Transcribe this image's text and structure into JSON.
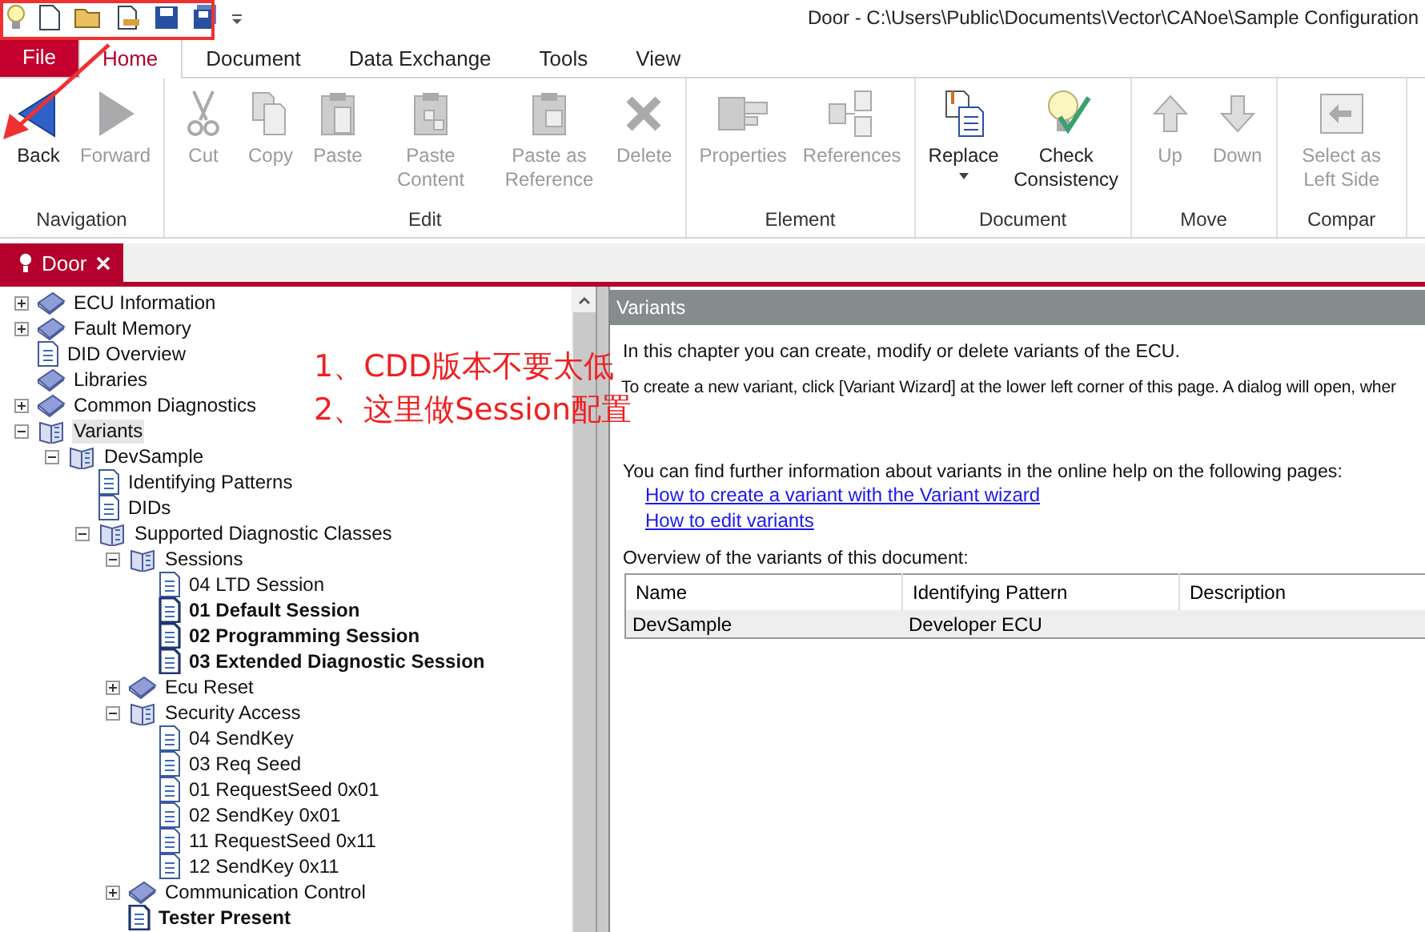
{
  "window": {
    "title": "Door - C:\\Users\\Public\\Documents\\Vector\\CANoe\\Sample Configuration"
  },
  "ribbon": {
    "tabs": [
      {
        "label": "File",
        "kind": "file",
        "selected": false
      },
      {
        "label": "Home",
        "kind": "tab",
        "selected": true
      },
      {
        "label": "Document",
        "kind": "tab",
        "selected": false
      },
      {
        "label": "Data Exchange",
        "kind": "tab",
        "selected": false
      },
      {
        "label": "Tools",
        "kind": "tab",
        "selected": false
      },
      {
        "label": "View",
        "kind": "tab",
        "selected": false
      }
    ],
    "groups": [
      {
        "label": "Navigation",
        "buttons": [
          {
            "label": "Back",
            "disabled": false
          },
          {
            "label": "Forward",
            "disabled": true
          }
        ]
      },
      {
        "label": "Edit",
        "buttons": [
          {
            "label": "Cut",
            "disabled": true
          },
          {
            "label": "Copy",
            "disabled": true
          },
          {
            "label": "Paste",
            "disabled": true
          },
          {
            "label": "Paste Content",
            "disabled": true
          },
          {
            "label": "Paste as Reference",
            "disabled": true
          },
          {
            "label": "Delete",
            "disabled": true
          }
        ]
      },
      {
        "label": "Element",
        "buttons": [
          {
            "label": "Properties",
            "disabled": true
          },
          {
            "label": "References",
            "disabled": true
          }
        ]
      },
      {
        "label": "Document",
        "buttons": [
          {
            "label": "Replace",
            "disabled": false,
            "dropdown": true
          },
          {
            "label": "Check Consistency",
            "disabled": false
          }
        ]
      },
      {
        "label": "Move",
        "buttons": [
          {
            "label": "Up",
            "disabled": true
          },
          {
            "label": "Down",
            "disabled": true
          }
        ]
      },
      {
        "label": "Compar",
        "buttons": [
          {
            "label": "Select as Left Side",
            "disabled": true
          }
        ]
      }
    ]
  },
  "document_tab": {
    "title": "Door"
  },
  "tree": [
    {
      "label": "ECU Information",
      "kind": "book",
      "expanded": false,
      "bold": false,
      "selected": false
    },
    {
      "label": "Fault Memory",
      "kind": "book",
      "expanded": false,
      "bold": false,
      "selected": false
    },
    {
      "label": "DID Overview",
      "kind": "page",
      "bold": false,
      "selected": false
    },
    {
      "label": "Libraries",
      "kind": "book",
      "bold": false,
      "selected": false
    },
    {
      "label": "Common Diagnostics",
      "kind": "book",
      "expanded": false,
      "bold": false,
      "selected": false
    },
    {
      "label": "Variants",
      "kind": "open-book",
      "expanded": true,
      "bold": false,
      "selected": true,
      "children": [
        {
          "label": "DevSample",
          "kind": "open-book",
          "expanded": true,
          "bold": false,
          "selected": false,
          "children": [
            {
              "label": "Identifying Patterns",
              "kind": "page",
              "bold": false,
              "selected": false
            },
            {
              "label": "DIDs",
              "kind": "page",
              "bold": false,
              "selected": false
            },
            {
              "label": "Supported Diagnostic Classes",
              "kind": "open-book",
              "expanded": true,
              "bold": false,
              "selected": false,
              "children": [
                {
                  "label": "Sessions",
                  "kind": "open-book",
                  "expanded": true,
                  "bold": false,
                  "selected": false,
                  "children": [
                    {
                      "label": "04 LTD Session",
                      "kind": "page",
                      "bold": false,
                      "selected": false
                    },
                    {
                      "label": "01 Default Session",
                      "kind": "page",
                      "bold": true,
                      "selected": false
                    },
                    {
                      "label": "02 Programming Session",
                      "kind": "page",
                      "bold": true,
                      "selected": false
                    },
                    {
                      "label": "03 Extended Diagnostic Session",
                      "kind": "page",
                      "bold": true,
                      "selected": false
                    }
                  ]
                },
                {
                  "label": "Ecu Reset",
                  "kind": "book",
                  "expanded": false,
                  "bold": false,
                  "selected": false
                },
                {
                  "label": "Security Access",
                  "kind": "open-book",
                  "expanded": true,
                  "bold": false,
                  "selected": false,
                  "children": [
                    {
                      "label": "04 SendKey",
                      "kind": "page",
                      "bold": false,
                      "selected": false
                    },
                    {
                      "label": "03 Req Seed",
                      "kind": "page",
                      "bold": false,
                      "selected": false
                    },
                    {
                      "label": "01 RequestSeed 0x01",
                      "kind": "page",
                      "bold": false,
                      "selected": false
                    },
                    {
                      "label": "02 SendKey 0x01",
                      "kind": "page",
                      "bold": false,
                      "selected": false
                    },
                    {
                      "label": "11 RequestSeed 0x11",
                      "kind": "page",
                      "bold": false,
                      "selected": false
                    },
                    {
                      "label": "12 SendKey 0x11",
                      "kind": "page",
                      "bold": false,
                      "selected": false
                    }
                  ]
                },
                {
                  "label": "Communication Control",
                  "kind": "book",
                  "expanded": false,
                  "bold": false,
                  "selected": false
                },
                {
                  "label": "Tester Present",
                  "kind": "page",
                  "bold": true,
                  "selected": false
                }
              ]
            }
          ]
        }
      ]
    }
  ],
  "content": {
    "header": "Variants",
    "paragraphs": [
      "In this chapter you can create, modify or delete variants of the ECU.",
      "To create a new variant, click [Variant Wizard] at the lower left corner of this page. A dialog will open, wher"
    ],
    "help_intro": "You can find further information about variants in the online help on the following pages:",
    "links": [
      "How to create a variant with the Variant wizard",
      "How to edit variants"
    ],
    "overview_label": "Overview of the variants of this document:",
    "table": {
      "columns": [
        "Name",
        "Identifying Pattern",
        "Description"
      ],
      "rows": [
        [
          "DevSample",
          "Developer ECU",
          ""
        ]
      ]
    }
  },
  "annotation": {
    "lines": [
      "1、CDD版本不要太低",
      "2、这里做Session配置"
    ]
  }
}
